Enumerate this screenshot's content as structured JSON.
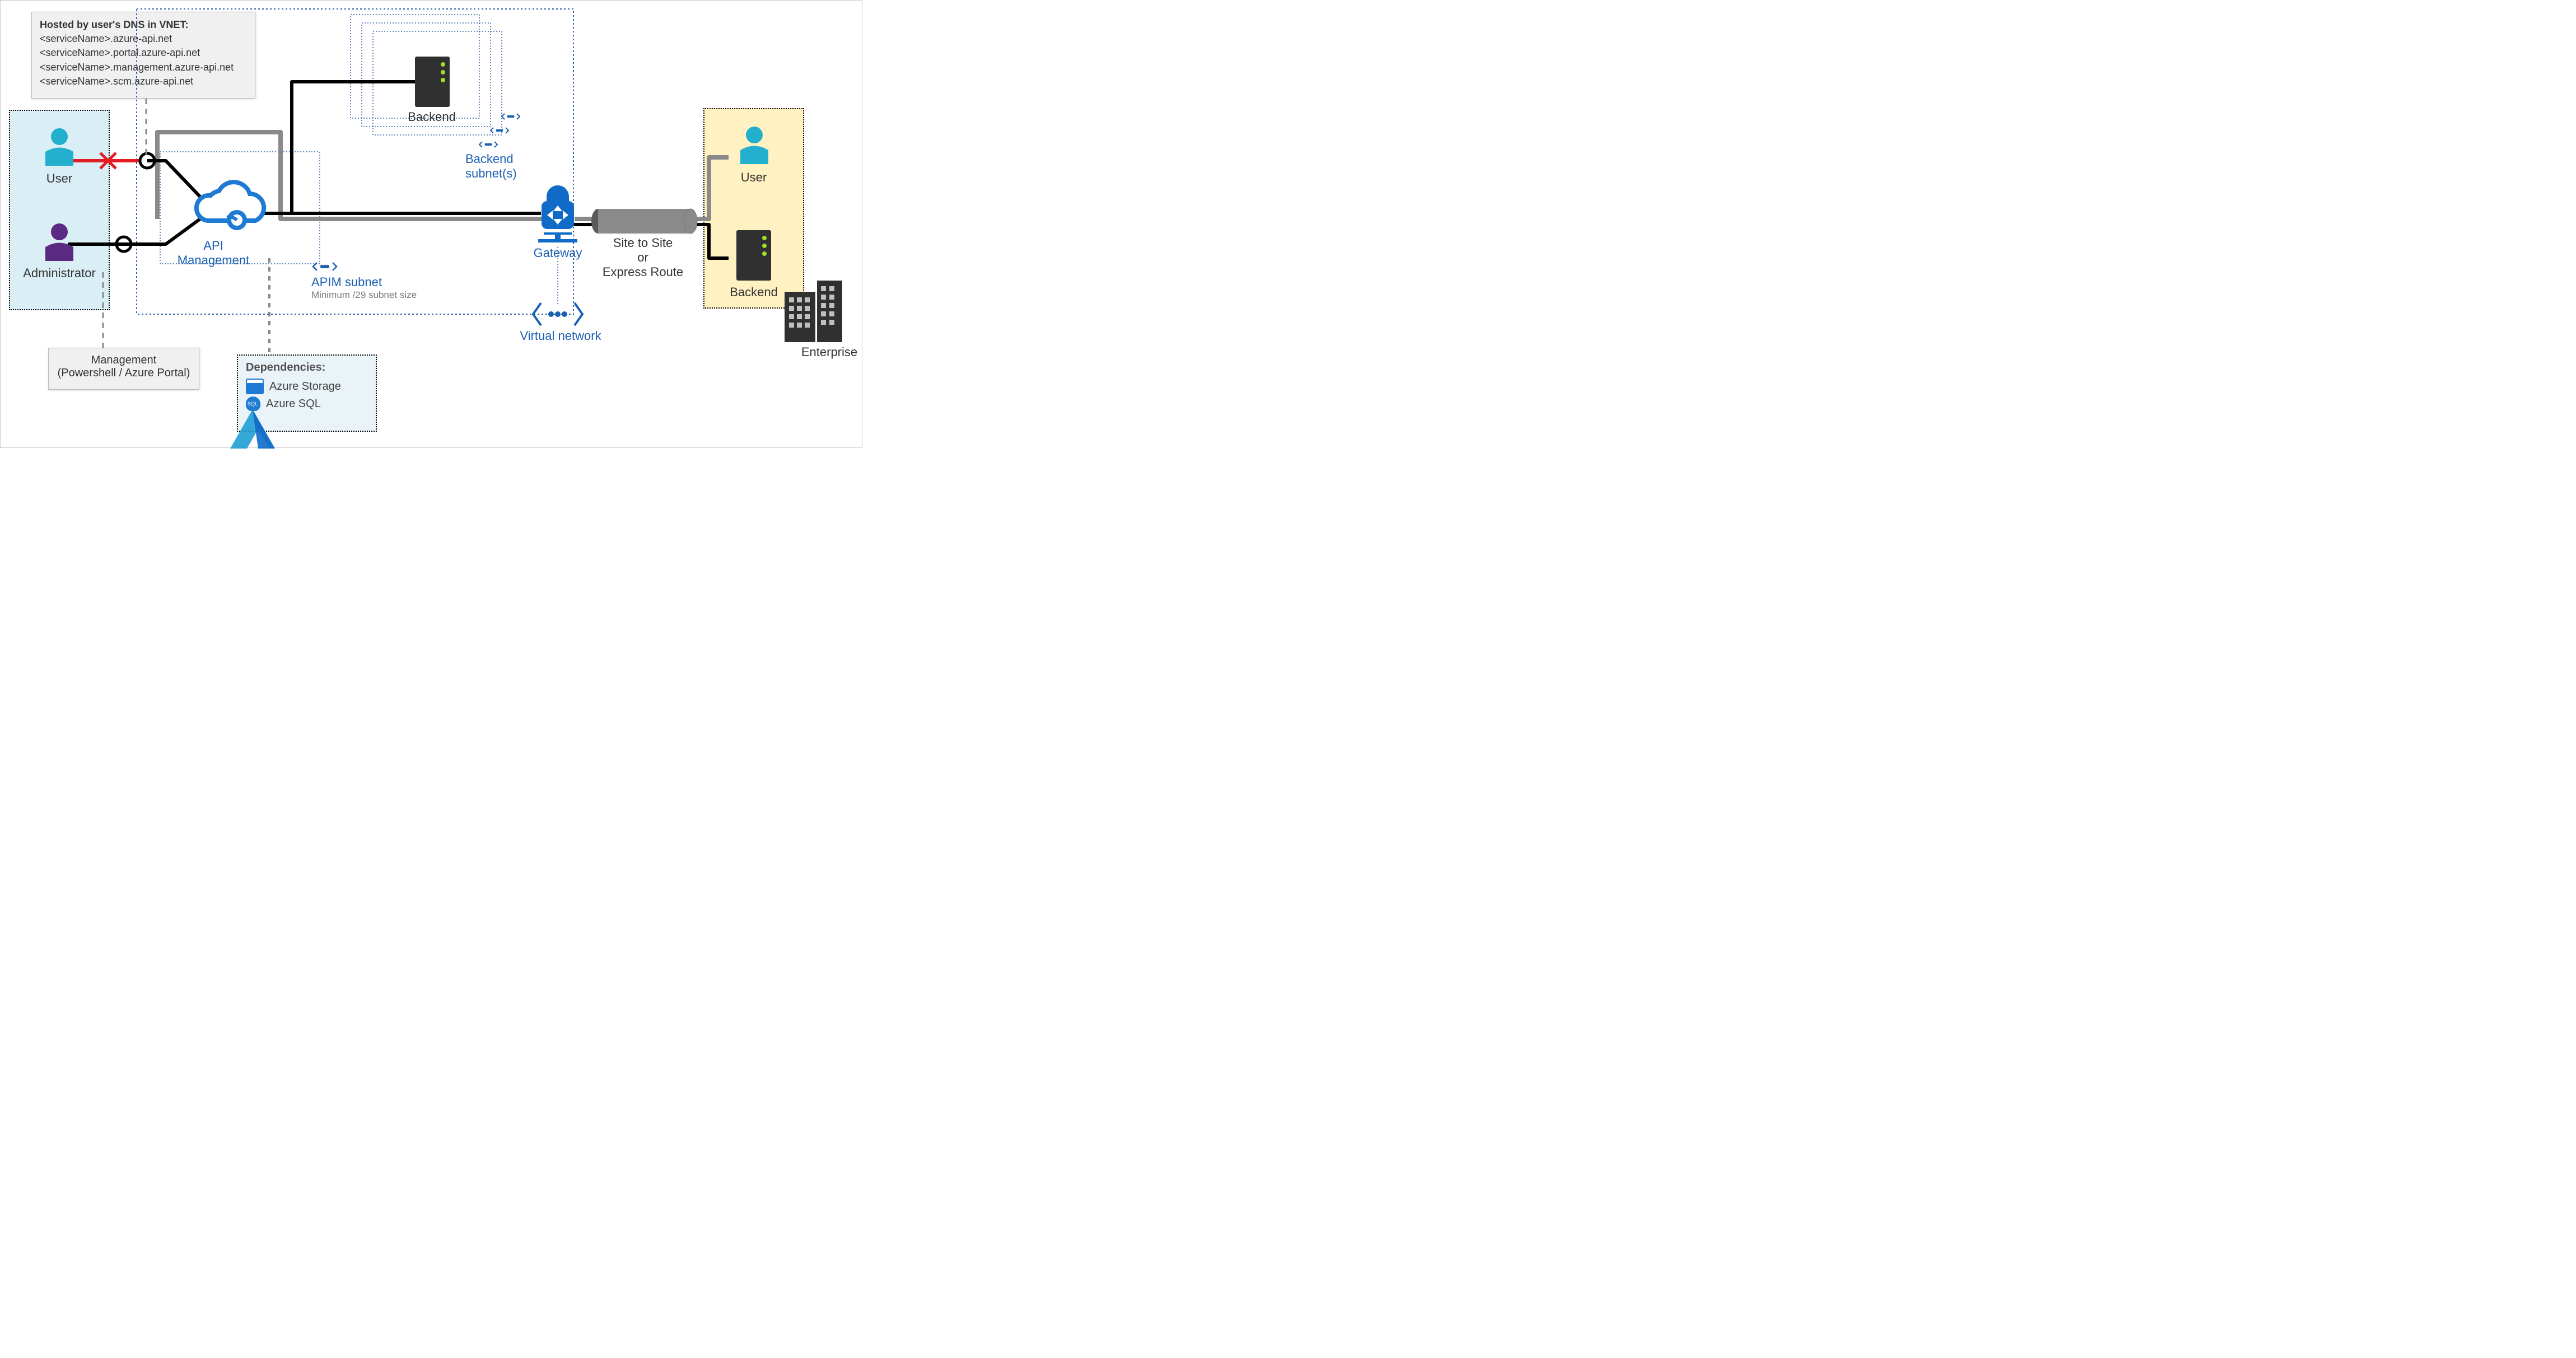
{
  "dns": {
    "title": "Hosted by user's DNS in VNET:",
    "lines": [
      "<serviceName>.azure-api.net",
      "<serviceName>.portal.azure-api.net",
      "<serviceName>.management.azure-api.net",
      "<serviceName>.scm.azure-api.net"
    ]
  },
  "left": {
    "user": "User",
    "admin": "Administrator"
  },
  "right": {
    "user": "User",
    "backend": "Backend",
    "enterprise": "Enterprise"
  },
  "center": {
    "api_mgmt": "API Management",
    "backend": "Backend",
    "backend_subnets": "Backend\nsubnet(s)",
    "apim_subnet": "APIM subnet",
    "apim_subnet_sub": "Minimum /29 subnet size",
    "gateway": "Gateway",
    "vnet": "Virtual network",
    "site_to_site": "Site to Site\nor\nExpress Route"
  },
  "management": {
    "line1": "Management",
    "line2": "(Powershell / Azure Portal)"
  },
  "deps": {
    "title": "Dependencies:",
    "storage": "Azure Storage",
    "sql": "Azure SQL"
  },
  "colors": {
    "azure_blue": "#1f7ad4",
    "dark_blue": "#195fa8",
    "teal": "#23b0ce",
    "purple": "#5a2a82",
    "gray": "#8a8a8a",
    "red": "#e31b23",
    "yellow_bg": "#fff1c2",
    "cyan_bg": "#daeef5"
  }
}
